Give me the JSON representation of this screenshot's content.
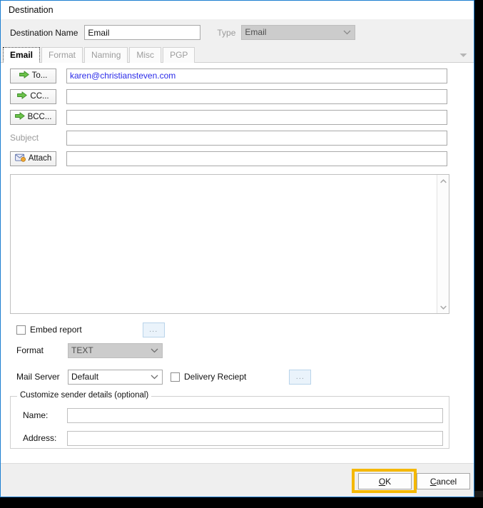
{
  "window": {
    "title": "Destination"
  },
  "header": {
    "destination_name_label": "Destination Name",
    "destination_name_value": "Email",
    "destination_name_placeholder": "",
    "type_label": "Type",
    "type_value": "Email"
  },
  "tabs": [
    {
      "label": "Email",
      "active": true
    },
    {
      "label": "Format",
      "active": false
    },
    {
      "label": "Naming",
      "active": false
    },
    {
      "label": "Misc",
      "active": false
    },
    {
      "label": "PGP",
      "active": false
    }
  ],
  "tab_overflow_icon": "chevron-down-icon",
  "email_tab": {
    "rows": [
      {
        "button_label": "To...",
        "icon": "green-arrow-icon",
        "value": "karen@christiansteven.com",
        "is_button": true
      },
      {
        "button_label": "CC...",
        "icon": "green-arrow-icon",
        "value": "",
        "is_button": true
      },
      {
        "button_label": "BCC...",
        "icon": "green-arrow-icon",
        "value": "",
        "is_button": true
      },
      {
        "button_label": "Subject",
        "icon": "",
        "value": "",
        "is_button": false
      },
      {
        "button_label": "Attach",
        "icon": "envelope-icon",
        "value": "",
        "is_button": true
      }
    ],
    "message_body_value": "",
    "scrollbar": {
      "up_icon": "chevron-up-icon",
      "down_icon": "chevron-down-icon"
    },
    "embed_report": {
      "label": "Embed report",
      "checked": false,
      "browse_label": "..."
    },
    "format": {
      "label": "Format",
      "value": "TEXT",
      "disabled": true
    },
    "mail_server": {
      "label": "Mail Server",
      "value": "Default",
      "disabled": false
    },
    "delivery_receipt": {
      "label": "Delivery Reciept",
      "checked": false,
      "browse_label": "..."
    },
    "sender_group": {
      "title": "Customize sender details (optional)",
      "name_label": "Name:",
      "name_value": "",
      "address_label": "Address:",
      "address_value": ""
    }
  },
  "footer": {
    "ok_mnemonic": "O",
    "ok_rest": "K",
    "cancel_mnemonic": "C",
    "cancel_rest": "ancel"
  },
  "annotation": {
    "highlight_color": "#f5b800",
    "highlight_target": "ok-button"
  },
  "colors": {
    "dialog_border": "#1d7fd1",
    "header_background": "#f0f0f0",
    "footer_background": "#efefef",
    "email_text": "#2a2ae8",
    "disabled_text": "#9a9a9a",
    "browse_button_fill": "#eaf3fb"
  }
}
